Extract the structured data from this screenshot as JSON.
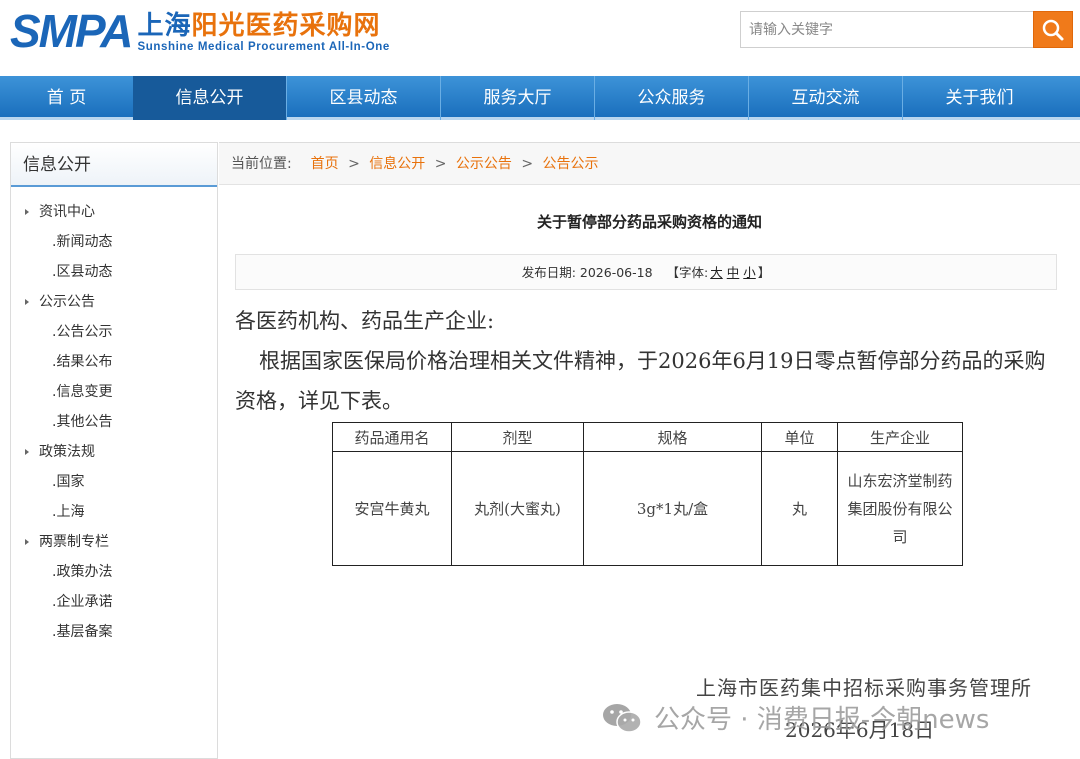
{
  "header": {
    "logo_mark": "SMPA",
    "logo_cn_part1": "上海",
    "logo_cn_part2": "阳光医药采购网",
    "logo_en": "Sunshine Medical Procurement All-In-One",
    "search_placeholder": "请输入关键字",
    "colors": {
      "brand_blue": "#1b66b8",
      "brand_orange": "#e8720c"
    }
  },
  "nav": {
    "items": [
      "首 页",
      "信息公开",
      "区县动态",
      "服务大厅",
      "公众服务",
      "互动交流",
      "关于我们"
    ],
    "active": "信息公开"
  },
  "sidebar": {
    "title": "信息公开",
    "groups": [
      {
        "label": "资讯中心",
        "items": [
          ".新闻动态",
          ".区县动态"
        ]
      },
      {
        "label": "公示公告",
        "items": [
          ".公告公示",
          ".结果公布",
          ".信息变更",
          ".其他公告"
        ]
      },
      {
        "label": "政策法规",
        "items": [
          ".国家",
          ".上海"
        ]
      },
      {
        "label": "两票制专栏",
        "items": [
          ".政策办法",
          ".企业承诺",
          ".基层备案"
        ]
      }
    ]
  },
  "breadcrumb": {
    "prefix": "当前位置:",
    "links": [
      "首页",
      "信息公开",
      "公示公告",
      "公告公示"
    ],
    "separator": ">"
  },
  "article": {
    "title": "关于暂停部分药品采购资格的通知",
    "date_label": "发布日期:",
    "date": "2026-06-18",
    "font_label": "【字体:",
    "font_large": "大",
    "font_medium": "中",
    "font_small": "小",
    "font_close": "】",
    "salutation": "各医药机构、药品生产企业:",
    "body": "根据国家医保局价格治理相关文件精神，于2026年6月19日零点暂停部分药品的采购资格，详见下表。",
    "table": {
      "headers": [
        "药品通用名",
        "剂型",
        "规格",
        "单位",
        "生产企业"
      ],
      "rows": [
        [
          "安宫牛黄丸",
          "丸剂(大蜜丸)",
          "3g*1丸/盒",
          "丸",
          "山东宏济堂制药集团股份有限公司"
        ]
      ]
    },
    "footer_org": "上海市医药集中招标采购事务管理所",
    "footer_date": "2026年6月18日"
  },
  "watermark": {
    "text": "公众号 · 消费日报-今朝news",
    "icon": "wechat-icon"
  }
}
